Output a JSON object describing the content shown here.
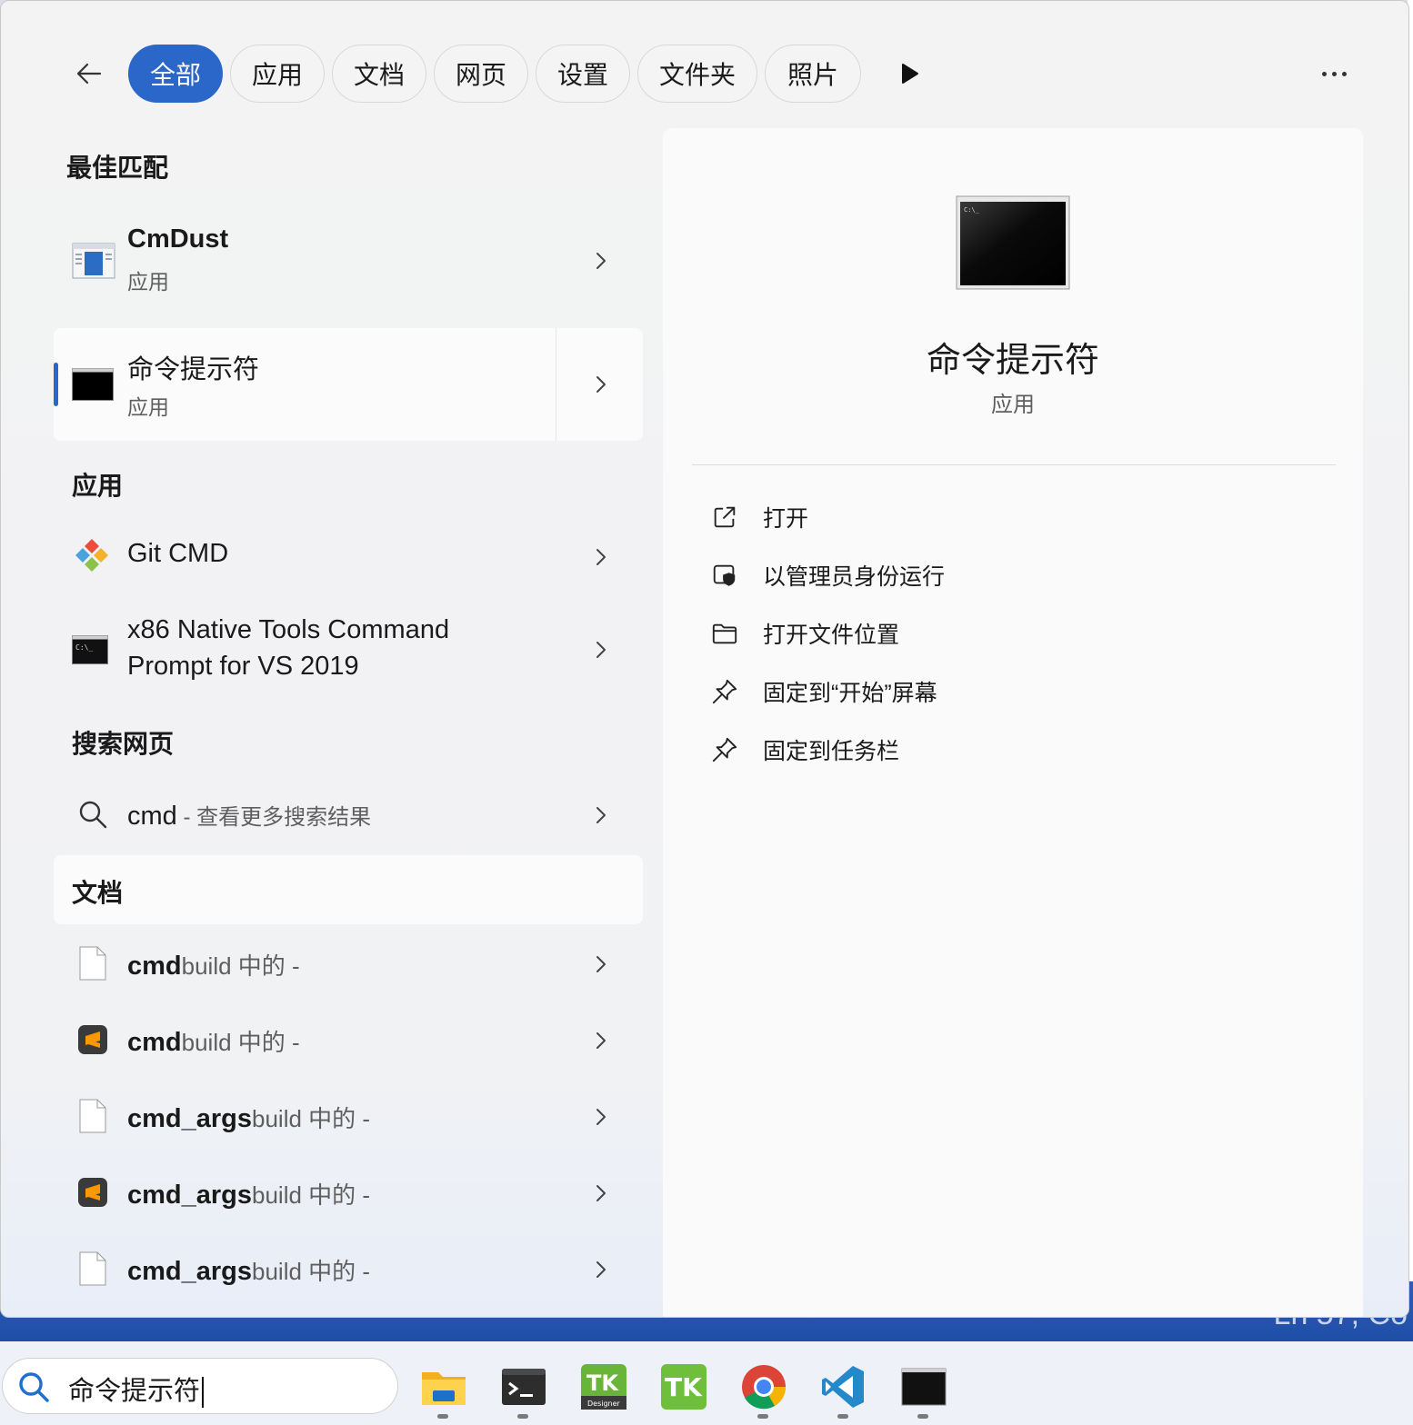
{
  "filters": {
    "back_icon": "arrow-left-icon",
    "chips": [
      "全部",
      "应用",
      "文档",
      "网页",
      "设置",
      "文件夹",
      "照片"
    ],
    "active_chip": "全部",
    "more_icon": "play-icon",
    "overflow_icon": "ellipsis-icon"
  },
  "best_match": {
    "heading": "最佳匹配",
    "items": [
      {
        "title": "CmDust",
        "subtitle": "应用",
        "icon": "cmdust-app-icon"
      },
      {
        "title": "命令提示符",
        "subtitle": "应用",
        "icon": "cmd-terminal-icon",
        "selected": true
      }
    ]
  },
  "apps": {
    "heading": "应用",
    "items": [
      {
        "title_bold": "Git CMD",
        "icon": "git-icon"
      },
      {
        "title_line1": "x86 Native Tools Command",
        "title_line2": "Prompt for VS 2019",
        "icon": "cmd-terminal-icon"
      }
    ]
  },
  "web": {
    "heading": "搜索网页",
    "query": "cmd",
    "suffix": " - 查看更多搜索结果",
    "icon": "search-icon"
  },
  "documents": {
    "heading": "文档",
    "items": [
      {
        "name": "cmd",
        "rest": "build 中的 -",
        "icon": "file-icon"
      },
      {
        "name": "cmd",
        "rest": "build 中的 -",
        "icon": "sublime-icon"
      },
      {
        "name": "cmd_args",
        "rest": "build 中的 -",
        "icon": "file-icon"
      },
      {
        "name": "cmd_args",
        "rest": "build 中的 -",
        "icon": "sublime-icon"
      },
      {
        "name": "cmd_args",
        "rest": "build 中的 -",
        "icon": "file-icon"
      }
    ]
  },
  "detail": {
    "app_name": "命令提示符",
    "app_type": "应用",
    "actions": [
      {
        "label": "打开",
        "icon": "open-external-icon"
      },
      {
        "label": "以管理员身份运行",
        "icon": "admin-shield-icon"
      },
      {
        "label": "打开文件位置",
        "icon": "folder-icon"
      },
      {
        "label": "固定到“开始”屏幕",
        "icon": "pin-icon"
      },
      {
        "label": "固定到任务栏",
        "icon": "pin-icon"
      }
    ]
  },
  "taskbar": {
    "search_text": "命令提示符",
    "apps": [
      "file-explorer-icon",
      "terminal-icon",
      "tk-designer-icon",
      "tk-icon",
      "chrome-icon",
      "vscode-icon",
      "cmd-icon"
    ]
  },
  "colors": {
    "accent": "#2b67c8"
  }
}
